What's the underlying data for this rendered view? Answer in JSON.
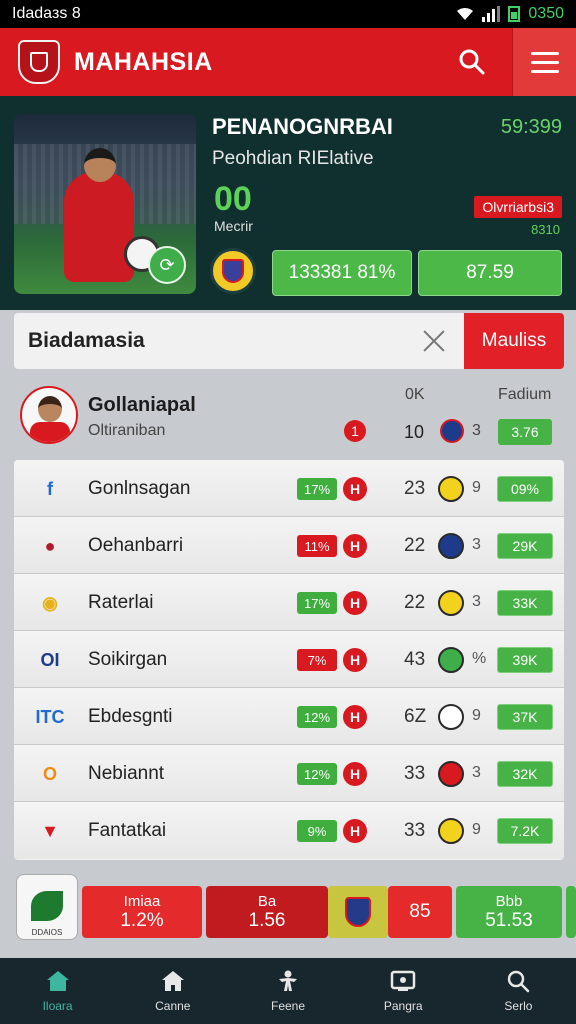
{
  "status_bar": {
    "carrier": "Idadaзs 8",
    "time": "0350"
  },
  "header": {
    "title": "MAHAHSIA",
    "search_icon": "search-icon",
    "menu_icon": "menu-icon"
  },
  "hero": {
    "title": "PENANOGNRBAI",
    "time": "59:399",
    "subtitle": "Peohdian RIElative",
    "score": "00",
    "score_label": "Mecrir",
    "tag": "Olvrriarbsi3",
    "tag_sub": "8310",
    "button_1": "133381 81%",
    "button_2": "87.59"
  },
  "search": {
    "value": "Biadamasia",
    "action_label": "Mauliss"
  },
  "featured": {
    "name": "Gollaniapal",
    "subtitle": "Oltiraniban",
    "badge": "1",
    "col1_label": "0K",
    "col2_label": "Fadium",
    "number": "10",
    "small": "3",
    "pill": "3.76"
  },
  "rows": [
    {
      "name": "Gonlnsagan",
      "pct": "17%",
      "pct_color": "#3fae3f",
      "h": "H",
      "num": "23",
      "small": "9",
      "pill": "09%",
      "team_color": "#f3d21e",
      "logo_color": "#1e6ad0",
      "logo_text": "f"
    },
    {
      "name": "Oehanbarri",
      "pct": "11%",
      "pct_color": "#d8191f",
      "h": "H",
      "num": "22",
      "small": "3",
      "pill": "29K",
      "team_color": "#1e3a8a",
      "logo_color": "#b31a2a",
      "logo_text": "●"
    },
    {
      "name": "Raterlai",
      "pct": "17%",
      "pct_color": "#3fae3f",
      "h": "H",
      "num": "22",
      "small": "3",
      "pill": "33K",
      "team_color": "#f3d21e",
      "logo_color": "#e5b21a",
      "logo_text": "◉"
    },
    {
      "name": "Soikirgan",
      "pct": "7%",
      "pct_color": "#d8191f",
      "h": "H",
      "num": "43",
      "small": "%",
      "pill": "39K",
      "team_color": "#3fae4a",
      "logo_color": "#1e3a8a",
      "logo_text": "OI"
    },
    {
      "name": "Ebdesgnti",
      "pct": "12%",
      "pct_color": "#3fae3f",
      "h": "H",
      "num": "6Z",
      "small": "9",
      "pill": "37K",
      "team_color": "#ffffff",
      "logo_color": "#1e6ad0",
      "logo_text": "ITC"
    },
    {
      "name": "Nebiannt",
      "pct": "12%",
      "pct_color": "#3fae3f",
      "h": "H",
      "num": "33",
      "small": "3",
      "pill": "32K",
      "team_color": "#d8191f",
      "logo_color": "#f08a14",
      "logo_text": "O"
    },
    {
      "name": "Fantatkai",
      "pct": "9%",
      "pct_color": "#3fae3f",
      "h": "H",
      "num": "33",
      "small": "9",
      "pill": "7.2K",
      "team_color": "#f3d21e",
      "logo_color": "#d8191f",
      "logo_text": "▼"
    }
  ],
  "ticker": {
    "avatar_caption": "DDAIOS",
    "cards": [
      {
        "l1": "Imiaa",
        "l2": "1.2%"
      },
      {
        "l1": "Ba",
        "l2": "1.56"
      },
      {
        "l1": "",
        "l2": "85"
      },
      {
        "l1": "Bbb",
        "l2": "51.53"
      }
    ]
  },
  "tabs": [
    {
      "label": "Iloara",
      "icon": "home-icon"
    },
    {
      "label": "Canne",
      "icon": "house-icon"
    },
    {
      "label": "Feene",
      "icon": "player-icon"
    },
    {
      "label": "Pangra",
      "icon": "tv-icon"
    },
    {
      "label": "Serlo",
      "icon": "search-icon"
    }
  ]
}
